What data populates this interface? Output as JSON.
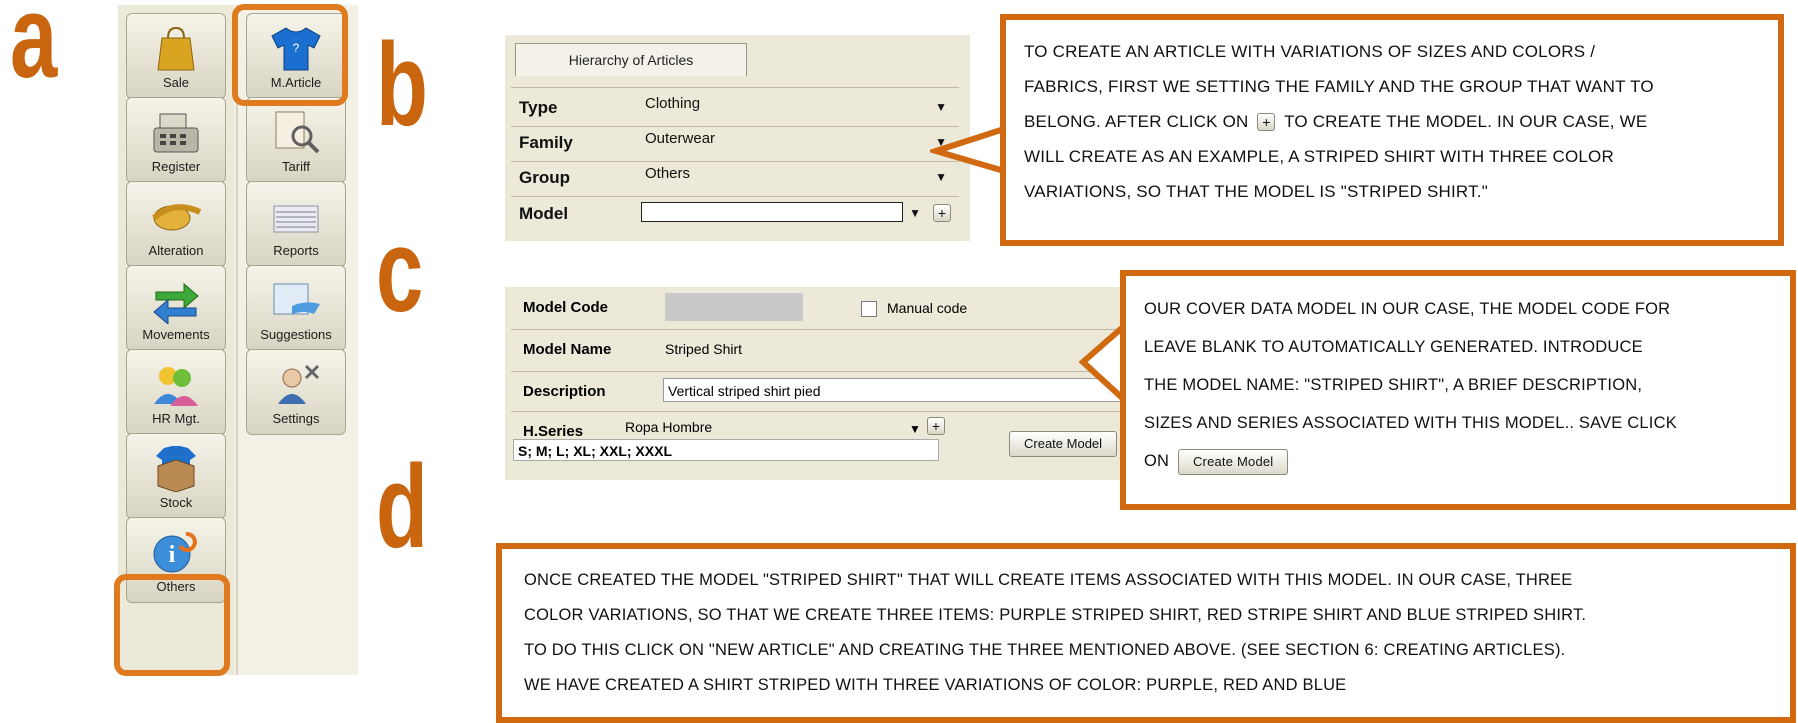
{
  "letters": {
    "a": "a",
    "b": "b",
    "c": "c",
    "d": "d"
  },
  "sidebar": {
    "col1": [
      {
        "label": "Sale",
        "icon": "shopping-bag-icon"
      },
      {
        "label": "Register",
        "icon": "cash-register-icon"
      },
      {
        "label": "Alteration",
        "icon": "tape-measure-icon"
      },
      {
        "label": "Movements",
        "icon": "exchange-arrows-icon"
      },
      {
        "label": "HR Mgt.",
        "icon": "people-icon"
      },
      {
        "label": "Stock",
        "icon": "stock-box-icon"
      },
      {
        "label": "Others",
        "icon": "info-icon"
      }
    ],
    "col2": [
      {
        "label": "M.Article",
        "icon": "shirt-icon"
      },
      {
        "label": "Tariff",
        "icon": "tariff-magnifier-icon"
      },
      {
        "label": "Reports",
        "icon": "reports-icon"
      },
      {
        "label": "Suggestions",
        "icon": "suggestions-icon"
      },
      {
        "label": "Settings",
        "icon": "settings-user-icon"
      }
    ]
  },
  "hierarchy": {
    "tab": "Hierarchy of Articles",
    "rows": [
      {
        "label": "Type",
        "value": "Clothing"
      },
      {
        "label": "Family",
        "value": "Outerwear"
      },
      {
        "label": "Group",
        "value": "Others"
      },
      {
        "label": "Model",
        "value": ""
      }
    ],
    "plus": "+"
  },
  "model_form": {
    "code_label": "Model Code",
    "code_value": "",
    "manual_code": "Manual code",
    "name_label": "Model Name",
    "name_value": "Striped Shirt",
    "desc_label": "Description",
    "desc_value": "Vertical striped shirt pied",
    "series_label": "H.Series",
    "series_value": "Ropa Hombre",
    "sizes": "S; M; L; XL; XXL; XXXL",
    "create_button": "Create Model",
    "plus": "+"
  },
  "callouts": {
    "b": {
      "line1": "TO CREATE AN ARTICLE WITH VARIATIONS OF SIZES AND COLORS /",
      "line2": "FABRICS, FIRST WE SETTING THE FAMILY AND THE GROUP THAT WANT TO",
      "line3a": "BELONG. AFTER CLICK ON",
      "line3b": "TO CREATE THE MODEL. IN OUR CASE, WE",
      "line4": "WILL CREATE AS AN EXAMPLE, A STRIPED SHIRT WITH THREE COLOR",
      "line5": "VARIATIONS, SO THAT THE MODEL IS \"STRIPED SHIRT.\"",
      "plus": "+"
    },
    "c": {
      "line1": "OUR COVER DATA MODEL IN OUR CASE, THE MODEL CODE FOR",
      "line2": "LEAVE BLANK TO AUTOMATICALLY GENERATED. INTRODUCE",
      "line3": "THE MODEL NAME: \"STRIPED SHIRT\",  A BRIEF DESCRIPTION,",
      "line4": "SIZES AND SERIES ASSOCIATED WITH THIS MODEL.. SAVE  CLICK",
      "line5a": "ON",
      "button": "Create Model"
    },
    "d": {
      "line1": "ONCE CREATED THE MODEL \"STRIPED SHIRT\" THAT WILL CREATE ITEMS ASSOCIATED WITH THIS MODEL. IN OUR CASE, THREE",
      "line2": "COLOR VARIATIONS, SO THAT WE CREATE THREE ITEMS: PURPLE STRIPED SHIRT, RED STRIPE SHIRT AND BLUE STRIPED SHIRT.",
      "line3": "TO DO THIS CLICK ON \"NEW ARTICLE\" AND CREATING THE THREE MENTIONED ABOVE. (SEE SECTION 6: CREATING ARTICLES).",
      "line4": "WE HAVE CREATED A SHIRT STRIPED WITH THREE VARIATIONS OF COLOR: PURPLE, RED AND BLUE"
    }
  },
  "colors": {
    "accent": "#d0690f",
    "panel": "#ece9d8"
  }
}
